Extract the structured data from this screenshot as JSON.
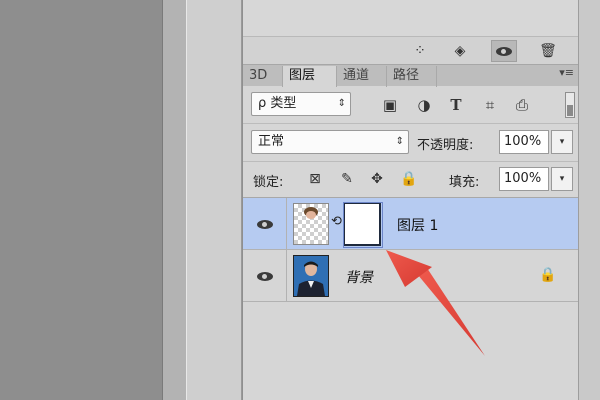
{
  "left_toolbar_icons": [
    "canvas",
    "strip"
  ],
  "prev_toolbar": {
    "icons": [
      "selection-icon",
      "adjust-icon",
      "eye-toggle-icon",
      "trash-icon"
    ]
  },
  "tabs": [
    {
      "label": "3D"
    },
    {
      "label": "图层"
    },
    {
      "label": "通道"
    },
    {
      "label": "路径"
    }
  ],
  "filter": {
    "kind_label": "ρ 类型",
    "kind_arrow": "⇕",
    "icons": [
      "image-filter-icon",
      "adjust-filter-icon",
      "text-filter-icon",
      "shape-filter-icon",
      "smart-object-filter-icon"
    ]
  },
  "blend": {
    "mode": "正常",
    "opacity_label": "不透明度:",
    "opacity_value": "100%"
  },
  "lock": {
    "label": "锁定:",
    "fill_label": "填充:",
    "fill_value": "100%"
  },
  "layers": [
    {
      "name": "图层 1",
      "selected": true,
      "has_mask": true
    },
    {
      "name": "背景",
      "selected": false,
      "locked": true
    }
  ],
  "colors": {
    "selected_layer": "#b6cbf1",
    "annotation_arrow": "#e8423a"
  }
}
